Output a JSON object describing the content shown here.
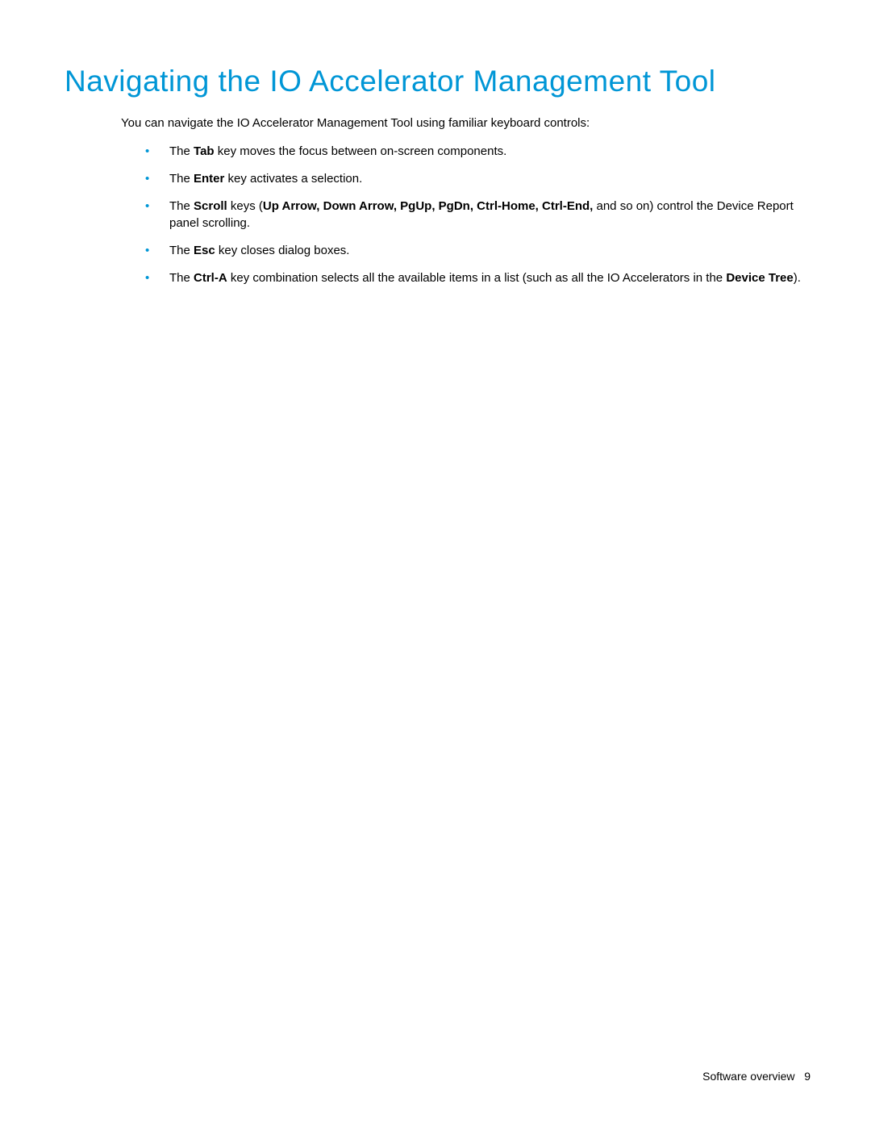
{
  "heading": "Navigating the IO Accelerator Management Tool",
  "intro": "You can navigate the IO Accelerator Management Tool using familiar keyboard controls:",
  "bullets": {
    "b1": {
      "t1": "The ",
      "k1": "Tab",
      "t2": " key moves the focus between on-screen components."
    },
    "b2": {
      "t1": "The ",
      "k1": "Enter",
      "t2": " key activates a selection."
    },
    "b3": {
      "t1": "The ",
      "k1": "Scroll",
      "t2": " keys (",
      "k2": "Up Arrow, Down Arrow, PgUp, PgDn, Ctrl-Home, Ctrl-End,",
      "t3": " and so on) control the Device Report panel scrolling."
    },
    "b4": {
      "t1": "The ",
      "k1": "Esc",
      "t2": " key closes dialog boxes."
    },
    "b5": {
      "t1": "The ",
      "k1": "Ctrl-A",
      "t2": " key combination selects all the available items in a list (such as all the IO Accelerators in the ",
      "k2": "Device Tree",
      "t3": ")."
    }
  },
  "footer": {
    "section": "Software overview",
    "page": "9"
  }
}
